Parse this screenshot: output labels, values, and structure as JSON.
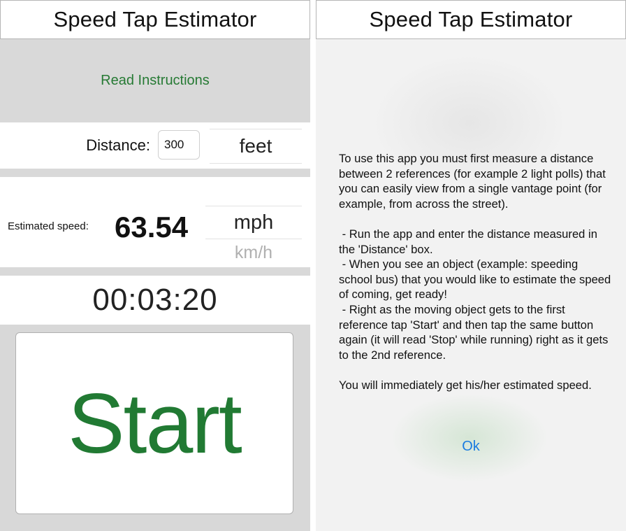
{
  "left_screen": {
    "title": "Speed Tap Estimator",
    "instructions_link": "Read Instructions",
    "distance_label": "Distance:",
    "distance_value": "300",
    "distance_unit": "feet",
    "speed_label": "Estimated speed:",
    "speed_value": "63.54",
    "speed_unit_selected": "mph",
    "speed_unit_other": "km/h",
    "timer": "00:03:20",
    "start_button": "Start"
  },
  "right_screen": {
    "title": "Speed Tap Estimator",
    "instructions_text": "To use this app you must first measure a distance between 2 references (for example 2 light polls) that you can easily view from a single vantage point (for example, from across the street).\n\n - Run the app and enter the distance measured in the 'Distance' box.\n - When you see an object (example: speeding school bus) that you would like to estimate the speed of coming, get ready!\n - Right as the moving object gets to the first reference tap 'Start' and then tap the same button again (it will read 'Stop' while running) right as it gets to the 2nd reference.\n\nYou will immediately get his/her estimated speed.",
    "ok_button": "Ok"
  },
  "colors": {
    "accent_green": "#217a33",
    "link_blue": "#1a7be0",
    "band_gray": "#d9d9d9"
  }
}
